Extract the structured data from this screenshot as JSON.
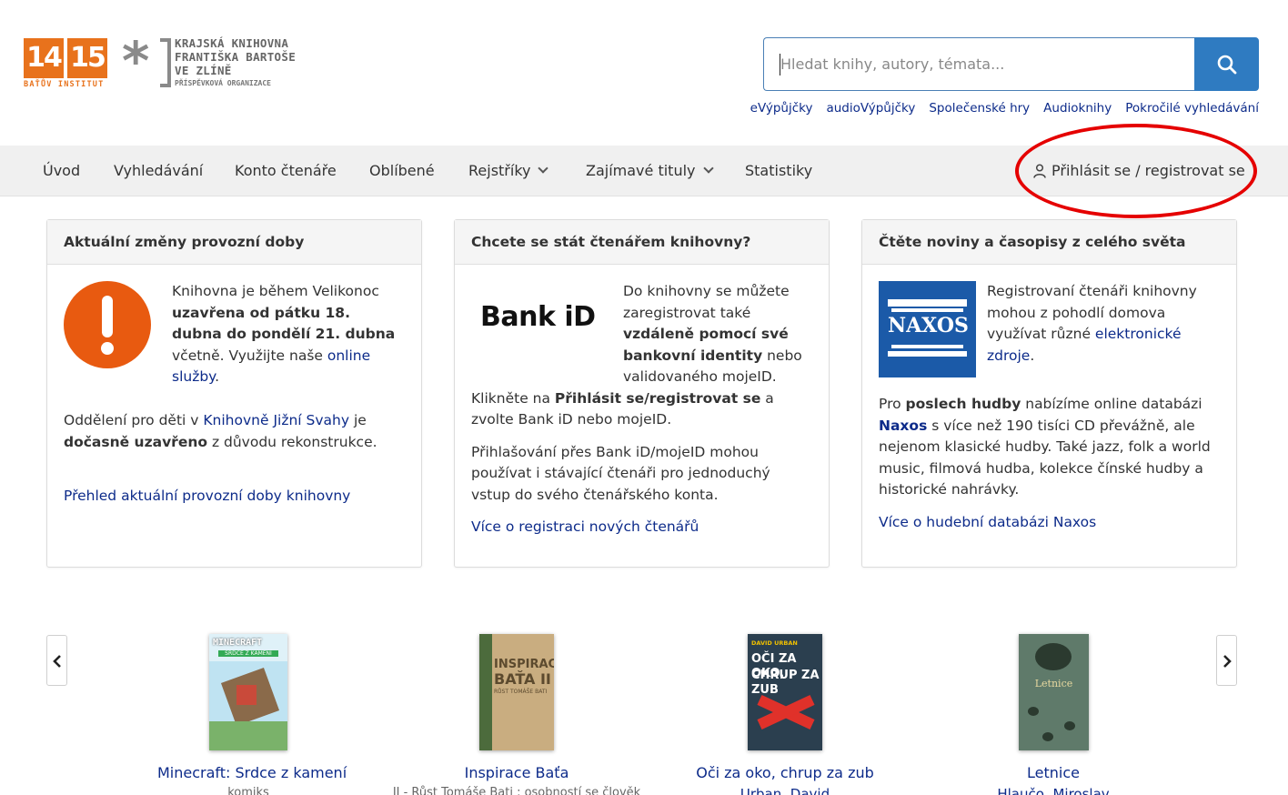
{
  "header": {
    "logo_1415": {
      "left": "14",
      "right": "15",
      "sub": "BAŤŮV INSTITUT"
    },
    "logo_library": {
      "lines": [
        "KRAJSKÁ KNIHOVNA",
        "FRANTIŠKA BARTOŠE",
        "VE ZLÍNĚ"
      ],
      "sub": "PŘÍSPĚVKOVÁ ORGANIZACE"
    },
    "search": {
      "placeholder": "Hledat knihy, autory, témata..."
    },
    "quicklinks": [
      "eVýpůjčky",
      "audioVýpůjčky",
      "Společenské hry",
      "Audioknihy",
      "Pokročilé vyhledávání"
    ]
  },
  "nav": {
    "items": [
      "Úvod",
      "Vyhledávání",
      "Konto čtenáře",
      "Oblíbené",
      "Rejstříky",
      "Zajímavé tituly",
      "Statistiky"
    ],
    "login": "Přihlásit se / registrovat se"
  },
  "cards": [
    {
      "title": "Aktuální změny provozní doby",
      "p1": [
        "Knihovna je během Velikonoc ",
        "uzavřena od pátku 18. dubna do pondělí 21. dubna",
        " včetně. Využijte naše ",
        "online služby",
        "."
      ],
      "p2": [
        "Oddělení pro děti v ",
        "Knihovně Jižní Svahy",
        " je ",
        "dočasně uzavřeno",
        " z důvodu rekonstrukce."
      ],
      "link": "Přehled aktuální provozní doby knihovny"
    },
    {
      "title": "Chcete se stát čtenářem knihovny?",
      "logo": "Bank iD",
      "p1": [
        "Do knihovny se můžete zaregistrovat také ",
        "vzdáleně pomocí své bankovní identity",
        " nebo validovaného mojeID."
      ],
      "p1b": [
        "Klikněte na ",
        "Přihlásit se/registrovat se",
        " a zvolte Bank iD nebo mojeID."
      ],
      "p2": "Přihlašování přes Bank iD/mojeID mohou používat i stávající čtenáři pro jednoduchý vstup do svého čtenářského konta.",
      "link": "Více o registraci nových čtenářů"
    },
    {
      "title": "Čtěte noviny a časopisy z celého světa",
      "logo": "NAXOS",
      "p1": [
        "Registrovaní čtenáři knihovny mohou z pohodlí domova využívat různé ",
        "elektronické zdroje",
        "."
      ],
      "p2": [
        "Pro ",
        "poslech hudby",
        " nabízíme online databázi ",
        "Naxos",
        " s více než 190 tisíci CD převážně, ale nejenom klasické hudby. Také jazz, folk a world music, filmová hudba, kolekce čínské hudby a historické nahrávky."
      ],
      "link": "Více o hudební databázi Naxos"
    }
  ],
  "books": [
    {
      "title": "Minecraft: Srdce z kamení",
      "sub": "komiks",
      "cover_text": [
        "MINECRAFT",
        "SRDCE Z KAMENÍ"
      ],
      "color": "#bfe3f2"
    },
    {
      "title": "Inspirace Baťa",
      "sub": "II - Růst Tomáše Bati : osobností se člověk",
      "cover_text": [
        "INSPIRACE",
        "BAŤA II",
        "RŮST TOMÁŠE BATI"
      ],
      "color": "#c9ad80"
    },
    {
      "title": "Oči za oko, chrup za zub",
      "sub": "Urban, David",
      "cover_text": [
        "DAVID URBAN",
        "OČI ZA OKO,",
        "CHRUP ZA ZUB"
      ],
      "color": "#2b3f4f"
    },
    {
      "title": "Letnice",
      "sub": "Hlaučo, Miroslav",
      "cover_text": [
        "Letnice"
      ],
      "color": "#5f7a6a"
    }
  ]
}
